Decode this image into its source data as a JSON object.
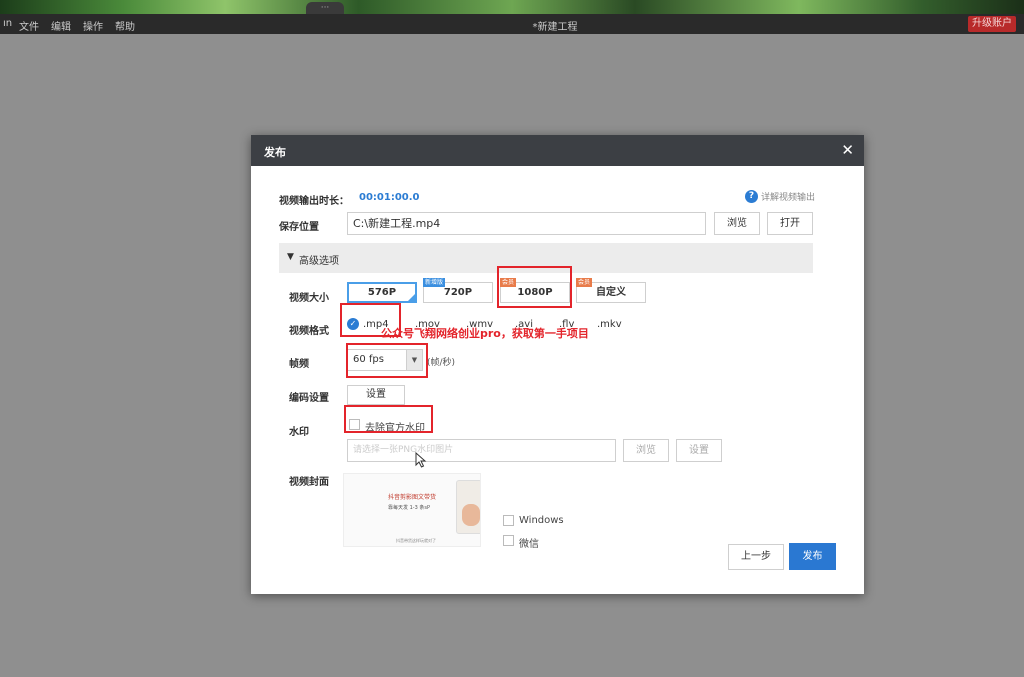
{
  "banner": {
    "handle": "···"
  },
  "menubar": {
    "items": [
      "ın",
      "文件",
      "编辑",
      "操作",
      "帮助"
    ],
    "doc_title": "*新建工程",
    "upgrade": "升级账户"
  },
  "dialog": {
    "title": "发布",
    "close_icon": "close-icon",
    "duration": {
      "label": "视频输出时长：",
      "value": "00:01:00.0"
    },
    "help_link": "详解视频输出",
    "save": {
      "label": "保存位置",
      "path": "C:\\新建工程.mp4",
      "browse": "浏览",
      "open": "打开"
    },
    "advanced": {
      "label": "高级选项"
    },
    "size": {
      "label": "视频大小",
      "options": [
        {
          "label": "576P",
          "tag": "",
          "selected": true
        },
        {
          "label": "720P",
          "tag": "新增版",
          "selected": false
        },
        {
          "label": "1080P",
          "tag": "会员",
          "selected": false
        },
        {
          "label": "自定义",
          "tag": "会员",
          "selected": false
        }
      ]
    },
    "format": {
      "label": "视频格式",
      "options": [
        ".mp4",
        ".mov",
        ".wmv",
        ".avi",
        ".flv",
        ".mkv"
      ],
      "selected": ".mp4"
    },
    "fps": {
      "label": "帧频",
      "value": "60 fps",
      "unit": "(帧/秒)"
    },
    "encode": {
      "label": "编码设置",
      "button": "设置"
    },
    "watermark": {
      "label": "水印",
      "remove": "去除官方水印",
      "placeholder": "请选择一张PNG水印图片",
      "browse": "浏览",
      "settings": "设置"
    },
    "cover": {
      "label": "视频封面",
      "title_text": "抖音剪影图文带货",
      "sub_text": "靠每天发 1-3 条sP",
      "foot_text": "抖音带货这样玩就对了",
      "windows": "Windows",
      "wechat": "微信"
    },
    "prev": "上一步",
    "publish": "发布"
  },
  "annotation": {
    "text": "公众号飞翔网络创业pro，获取第一手项目"
  },
  "colors": {
    "accent": "#2a78d2",
    "annotation": "#e3242b",
    "dialog_header": "#3c3f44"
  }
}
